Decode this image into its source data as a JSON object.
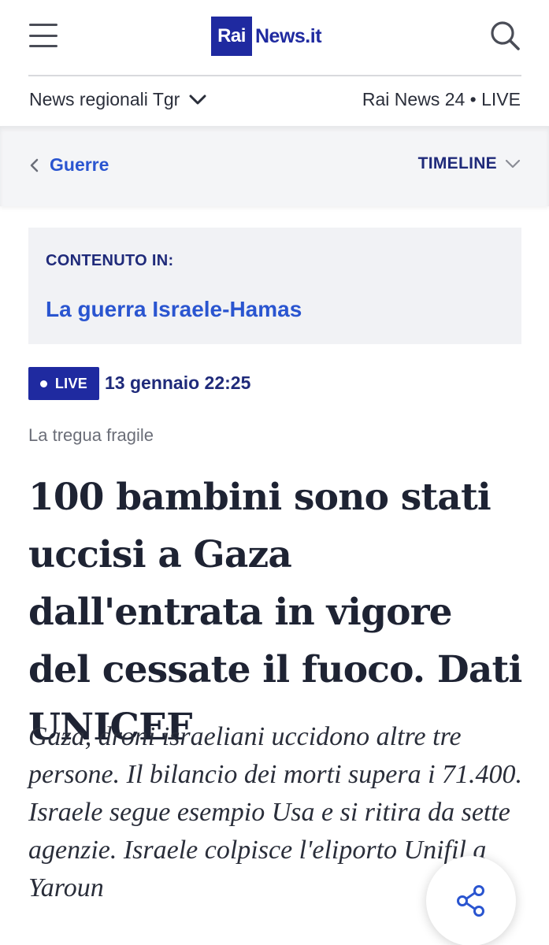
{
  "header": {
    "logo_rai": "Rai",
    "logo_news": "News.it",
    "menu_icon": "hamburger-menu-icon",
    "search_icon": "search-icon"
  },
  "subnav": {
    "regional_label": "News regionali Tgr",
    "live_label": "Rai News 24 • LIVE"
  },
  "breadcrumb": {
    "back_label": "Guerre",
    "timeline_label": "TIMELINE"
  },
  "content_in": {
    "label": "CONTENUTO IN:",
    "link": "La guerra Israele-Hamas"
  },
  "article": {
    "live_badge": "LIVE",
    "date": "13 gennaio 22:25",
    "kicker": "La tregua fragile",
    "headline": "100 bambini sono stati uccisi a Gaza dall'entrata in vigore del cessate il fuoco. Dati UNICEF",
    "summary": "Gaza, droni israeliani uccidono altre tre persone. Il bilancio dei morti supera i 71.400. Israele segue esempio Usa e si ritira da sette agenzie. Israele colpisce l'eliporto Unifil a Yaroun"
  },
  "colors": {
    "brand_blue": "#1f2aa0",
    "link_blue": "#2a55d0",
    "dark_navy": "#1f2a7a"
  }
}
